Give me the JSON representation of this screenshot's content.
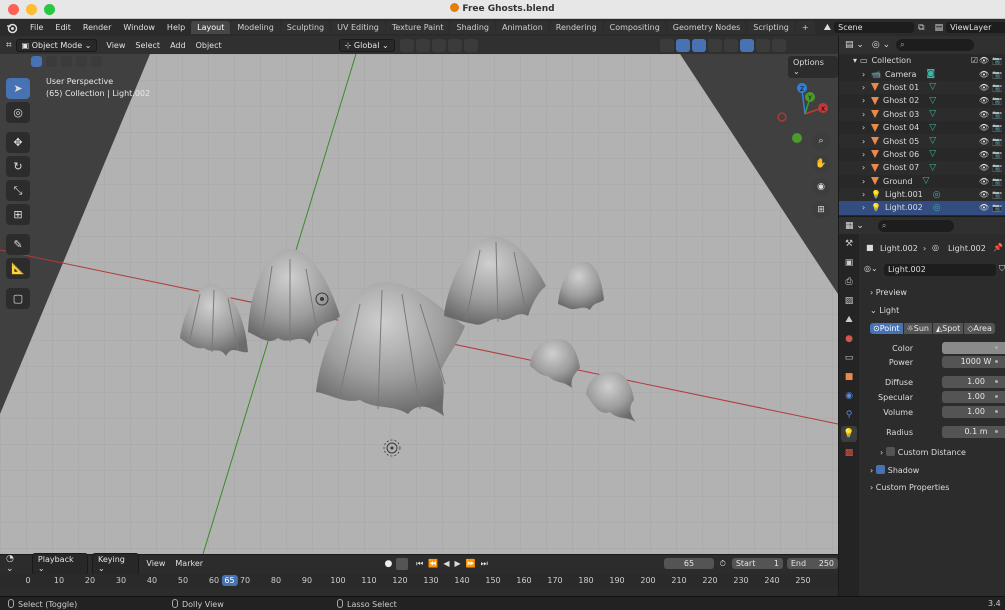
{
  "window": {
    "title": "Free Ghosts.blend"
  },
  "menubar": {
    "items": [
      "File",
      "Edit",
      "Render",
      "Window",
      "Help"
    ]
  },
  "workspaces": {
    "tabs": [
      "Layout",
      "Modeling",
      "Sculpting",
      "UV Editing",
      "Texture Paint",
      "Shading",
      "Animation",
      "Rendering",
      "Compositing",
      "Geometry Nodes",
      "Scripting"
    ],
    "active": "Layout",
    "add_label": "+"
  },
  "scene": {
    "name": "Scene",
    "view_layer": "ViewLayer"
  },
  "viewport": {
    "mode": "Object Mode",
    "menus": [
      "View",
      "Select",
      "Add",
      "Object"
    ],
    "orientation": "Global",
    "options_label": "Options",
    "info_line1": "User Perspective",
    "info_line2": "(65) Collection | Light.002",
    "gizmo_axes": [
      "X",
      "Y",
      "Z"
    ]
  },
  "timeline": {
    "playback_label": "Playback",
    "keying_label": "Keying",
    "view_label": "View",
    "marker_label": "Marker",
    "current_frame": "65",
    "start_label": "Start",
    "start_value": "1",
    "end_label": "End",
    "end_value": "250",
    "ruler": [
      0,
      10,
      20,
      30,
      40,
      50,
      60,
      70,
      80,
      90,
      100,
      110,
      120,
      130,
      140,
      150,
      160,
      170,
      180,
      190,
      200,
      210,
      220,
      230,
      240,
      250
    ],
    "frame_marker": "65"
  },
  "statusbar": {
    "left": "Select (Toggle)",
    "middle": "Dolly View",
    "right": "Lasso Select",
    "version": "3.4"
  },
  "outliner": {
    "collection": "Collection",
    "items": [
      {
        "name": "Camera",
        "type": "camera"
      },
      {
        "name": "Ghost 01",
        "type": "mesh"
      },
      {
        "name": "Ghost 02",
        "type": "mesh"
      },
      {
        "name": "Ghost 03",
        "type": "mesh"
      },
      {
        "name": "Ghost 04",
        "type": "mesh"
      },
      {
        "name": "Ghost 05",
        "type": "mesh"
      },
      {
        "name": "Ghost 06",
        "type": "mesh"
      },
      {
        "name": "Ghost 07",
        "type": "mesh"
      },
      {
        "name": "Ground",
        "type": "mesh"
      },
      {
        "name": "Light.001",
        "type": "light"
      },
      {
        "name": "Light.002",
        "type": "light",
        "selected": true
      }
    ]
  },
  "properties": {
    "breadcrumb_object": "Light.002",
    "breadcrumb_data": "Light.002",
    "datablock_name": "Light.002",
    "preview_label": "Preview",
    "light_label": "Light",
    "light_types": [
      "Point",
      "Sun",
      "Spot",
      "Area"
    ],
    "light_type_active": "Point",
    "color_label": "Color",
    "power_label": "Power",
    "power_value": "1000 W",
    "diffuse_label": "Diffuse",
    "diffuse_value": "1.00",
    "specular_label": "Specular",
    "specular_value": "1.00",
    "volume_label": "Volume",
    "volume_value": "1.00",
    "radius_label": "Radius",
    "radius_value": "0.1 m",
    "custom_distance_label": "Custom Distance",
    "shadow_label": "Shadow",
    "custom_props_label": "Custom Properties"
  },
  "colors": {
    "accent": "#4772b3",
    "x_axis": "#c03838",
    "y_axis": "#4a9a2c",
    "z_axis": "#2f80d8",
    "light_color_swatch": "#8a8a8a"
  }
}
